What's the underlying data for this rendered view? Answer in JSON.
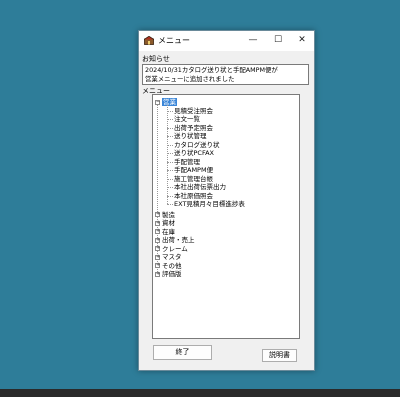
{
  "window": {
    "title": "メニュー",
    "minimize": "—",
    "maximize": "☐",
    "close": "✕"
  },
  "notice": {
    "label": "お知らせ",
    "text": "2024/10/31カタログ送り状と手配AMPM便が\n営業メニューに追加されました"
  },
  "menu": {
    "label": "メニュー",
    "root_selected": "営業",
    "eigyo_children": [
      "見積受注照会",
      "注文一覧",
      "出荷予定照会",
      "送り状管理",
      "カタログ送り状",
      "送り状PCFAX",
      "手配管理",
      "手配AMPM便",
      "施工管理台帳",
      "本社出荷伝票出力",
      "本社原価照会",
      "EXT見積月々目標進捗表"
    ],
    "other_roots": [
      "製造",
      "資材",
      "在庫",
      "出荷・売上",
      "クレーム",
      "マスタ",
      "その他",
      "評価版"
    ],
    "toggle_expanded": "−",
    "toggle_collapsed": "+"
  },
  "buttons": {
    "close_label": "終了",
    "help_label": "説明書"
  }
}
